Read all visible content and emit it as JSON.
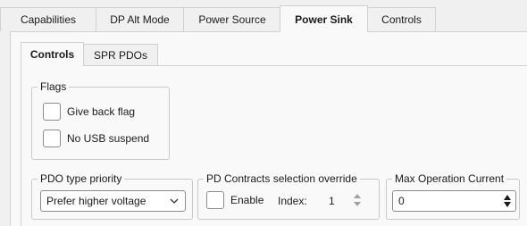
{
  "main_tabs": [
    {
      "label": "Capabilities",
      "active": false
    },
    {
      "label": "DP Alt Mode",
      "active": false
    },
    {
      "label": "Power Source",
      "active": false
    },
    {
      "label": "Power Sink",
      "active": true
    },
    {
      "label": "Controls",
      "active": false
    }
  ],
  "sub_tabs": [
    {
      "label": "Controls",
      "active": true
    },
    {
      "label": "SPR PDOs",
      "active": false
    }
  ],
  "flags": {
    "title": "Flags",
    "give_back_label": "Give back flag",
    "give_back_checked": false,
    "no_usb_suspend_label": "No USB suspend",
    "no_usb_suspend_checked": false
  },
  "pdo_priority": {
    "title": "PDO type priority",
    "selected": "Prefer higher voltage"
  },
  "contract_override": {
    "title": "PD Contracts selection override",
    "enable_label": "Enable",
    "enable_checked": false,
    "index_label": "Index:",
    "index_value": "1"
  },
  "max_current": {
    "title": "Max Operation Current",
    "value": "0"
  },
  "icons": {
    "dropdown": "chevron-down-icon",
    "spin": "spin-arrows-icon"
  }
}
